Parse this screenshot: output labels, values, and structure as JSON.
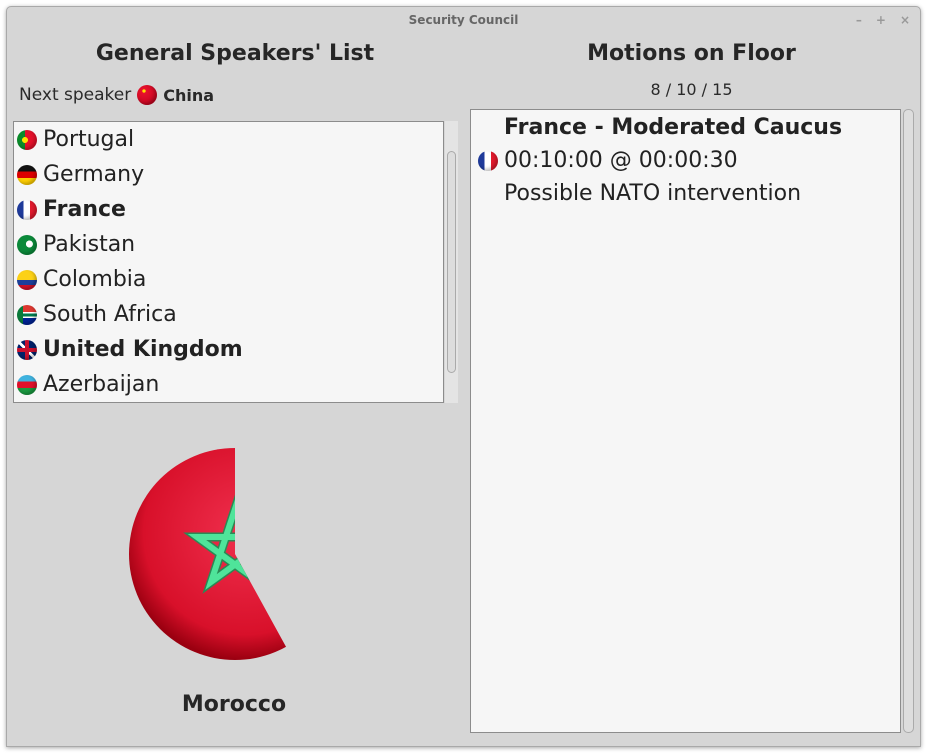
{
  "window": {
    "title": "Security Council",
    "minimize": "–",
    "maximize": "+",
    "close": "×"
  },
  "speakers": {
    "heading": "General Speakers' List",
    "next_label": "Next speaker",
    "next_country": "China",
    "items": [
      {
        "name": "Portugal",
        "bold": false,
        "flag": "portugal-flag-icon"
      },
      {
        "name": "Germany",
        "bold": false,
        "flag": "germany-flag-icon"
      },
      {
        "name": "France",
        "bold": true,
        "flag": "france-flag-icon"
      },
      {
        "name": "Pakistan",
        "bold": false,
        "flag": "pakistan-flag-icon"
      },
      {
        "name": "Colombia",
        "bold": false,
        "flag": "colombia-flag-icon"
      },
      {
        "name": "South Africa",
        "bold": false,
        "flag": "south-africa-flag-icon"
      },
      {
        "name": "United Kingdom",
        "bold": true,
        "flag": "united-kingdom-flag-icon"
      },
      {
        "name": "Azerbaijan",
        "bold": false,
        "flag": "azerbaijan-flag-icon"
      }
    ]
  },
  "current": {
    "country": "Morocco",
    "time_remaining_fraction": 0.58
  },
  "motions": {
    "heading": "Motions on Floor",
    "count": "8 / 10 / 15",
    "items": [
      {
        "title": "France - Moderated Caucus",
        "time": "00:10:00 @ 00:00:30",
        "description": "Possible NATO intervention"
      }
    ]
  },
  "colors": {
    "background": "#d6d6d6",
    "flag_red": "#d8102a",
    "star_green": "#4fe49a"
  }
}
